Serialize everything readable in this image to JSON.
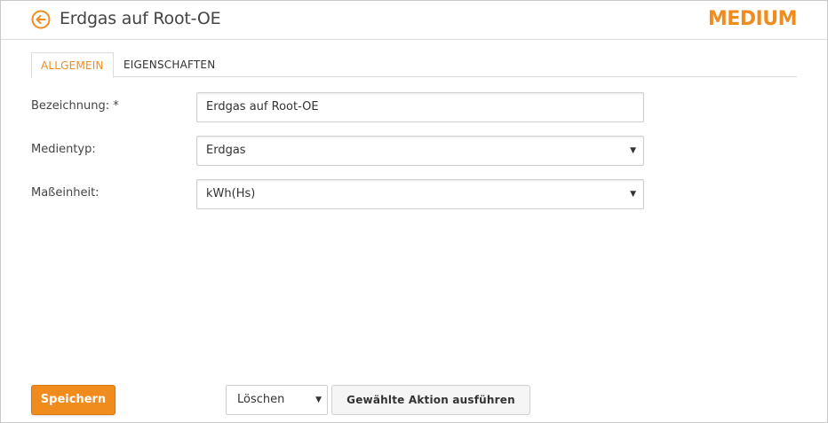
{
  "header": {
    "title": "Erdgas auf Root-OE",
    "brand": "MEDIUM",
    "back_icon": "arrow-left-circle-icon",
    "accent_color": "#f08c1e"
  },
  "tabs": [
    {
      "label": "ALLGEMEIN",
      "active": true
    },
    {
      "label": "EIGENSCHAFTEN",
      "active": false
    }
  ],
  "form": {
    "bezeichnung": {
      "label": "Bezeichnung: *",
      "value": "Erdgas auf Root-OE"
    },
    "medientyp": {
      "label": "Medientyp:",
      "value": "Erdgas"
    },
    "masseinheit": {
      "label": "Maßeinheit:",
      "value": "kWh(Hs)"
    }
  },
  "footer": {
    "save_label": "Speichern",
    "action_select_value": "Löschen",
    "apply_label": "Gewählte Aktion ausführen"
  },
  "icons": {
    "caret": "▼"
  }
}
